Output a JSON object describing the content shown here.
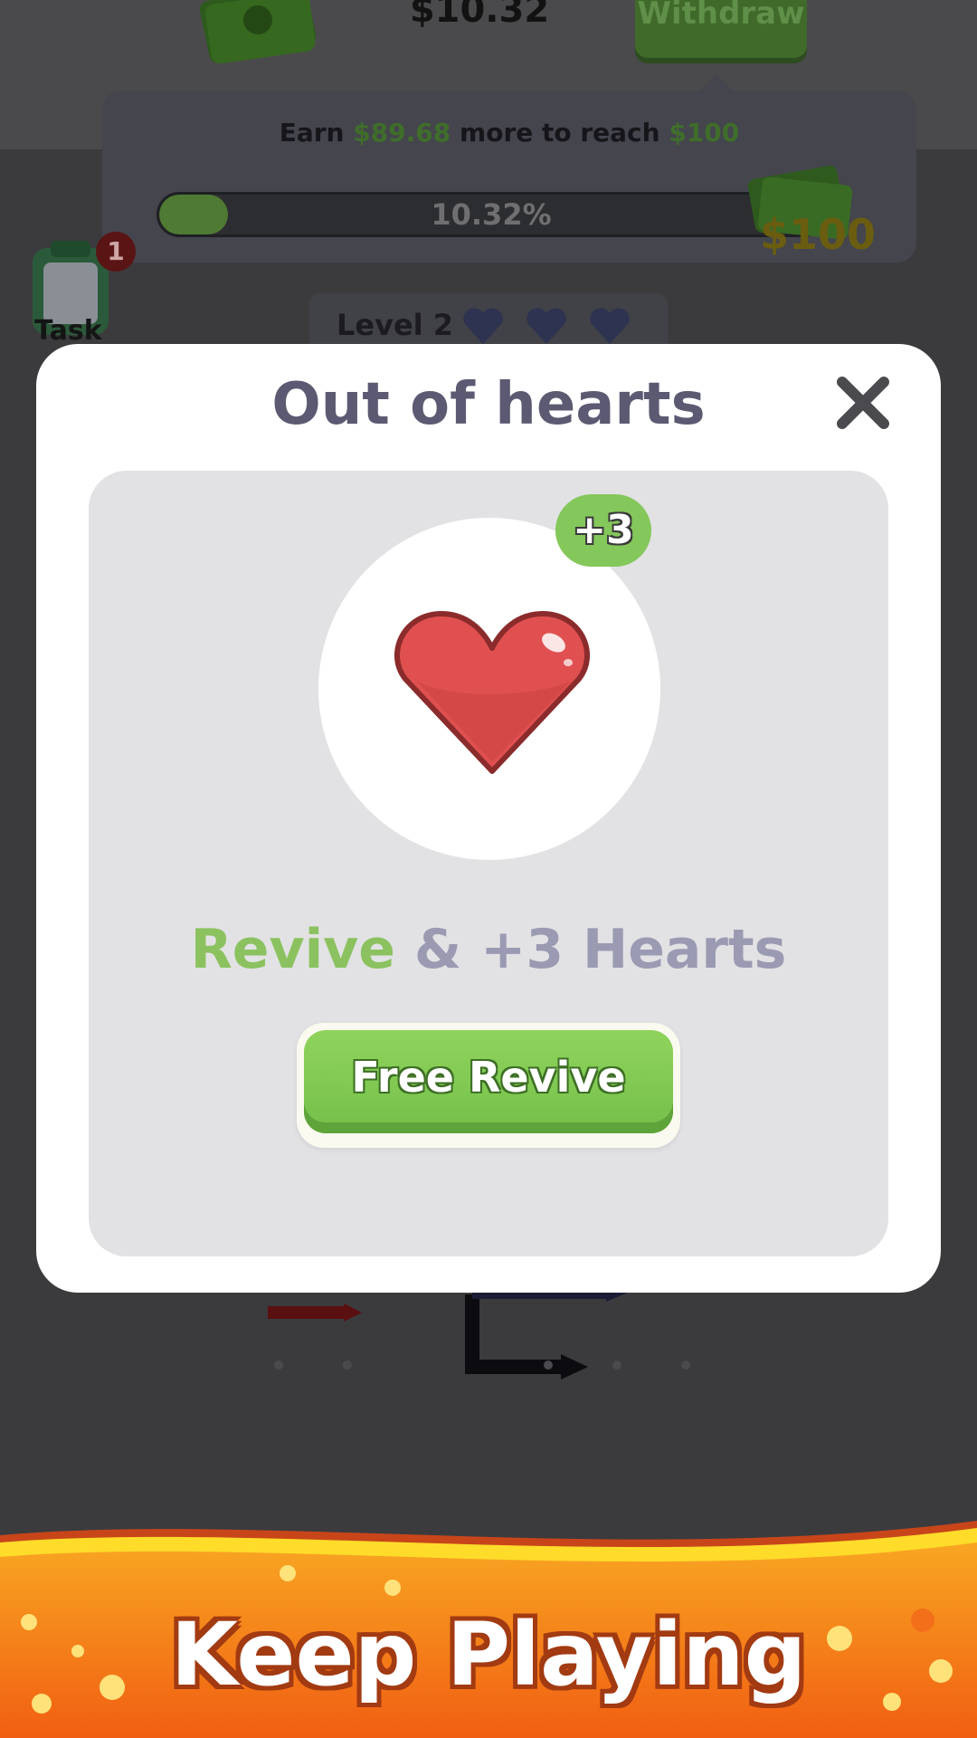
{
  "header": {
    "balance": "$10.32",
    "withdraw_label": "Withdraw"
  },
  "progress": {
    "earn_prefix": "Earn",
    "earn_amount": "$89.68",
    "earn_middle": "more to reach",
    "earn_target": "$100",
    "percent_label": "10.32%",
    "fraction": 0.1032,
    "goal_label": "$100"
  },
  "task": {
    "label": "Task",
    "badge": "1"
  },
  "level": {
    "label": "Level 2",
    "hearts": 3
  },
  "modal": {
    "title": "Out of hearts",
    "badge": "+3",
    "revive_word": "Revive",
    "revive_rest": "& +3 Hearts",
    "button_label": "Free Revive"
  },
  "banner": {
    "label": "Keep Playing"
  },
  "colors": {
    "accent_green": "#84c75a",
    "heart_red": "#e05050",
    "banner_orange": "#f6891f"
  },
  "icons": {
    "close": "close-icon",
    "heart": "heart-icon",
    "cash": "cash-stack-icon",
    "task": "clipboard-task-icon"
  }
}
